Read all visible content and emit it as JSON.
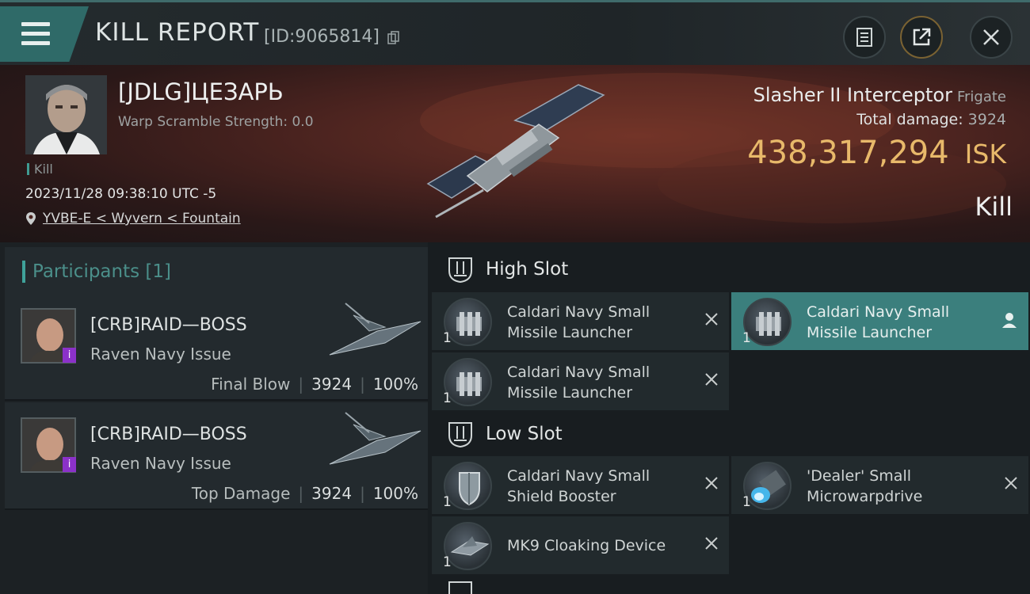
{
  "header": {
    "title": "KILL REPORT",
    "report_id": "[ID:9065814]"
  },
  "victim": {
    "name": "[JDLG]ЦЕЗАРЬ",
    "warp_scramble": "Warp Scramble Strength: 0.0",
    "tag": "Kill",
    "datetime": "2023/11/28 09:38:10 UTC -5",
    "location": "YVBE-E < Wyvern < Fountain",
    "ship": "Slasher II Interceptor",
    "ship_class": "Frigate",
    "total_damage_label": "Total damage:",
    "total_damage": "3924",
    "isk_value": "438,317,294",
    "isk_unit": "ISK",
    "result": "Kill"
  },
  "participants": {
    "label": "Participants",
    "count": "[1]",
    "items": [
      {
        "name": "[CRB]RAID—BOSS",
        "ship": "Raven Navy Issue",
        "role": "Final Blow",
        "damage": "3924",
        "percent": "100%"
      },
      {
        "name": "[CRB]RAID—BOSS",
        "ship": "Raven Navy Issue",
        "role": "Top Damage",
        "damage": "3924",
        "percent": "100%"
      }
    ]
  },
  "fitting": {
    "high_slot_label": "High Slot",
    "low_slot_label": "Low Slot",
    "high": [
      {
        "name": "Caldari Navy Small Missile Launcher",
        "qty": "1"
      },
      {
        "name": "Caldari Navy Small Missile Launcher",
        "qty": "1"
      },
      {
        "name": "Caldari Navy Small Missile Launcher",
        "qty": "1"
      }
    ],
    "low": [
      {
        "name": "Caldari Navy Small Shield Booster",
        "qty": "1"
      },
      {
        "name": "'Dealer' Small Microwarpdrive",
        "qty": "1"
      },
      {
        "name": "MK9 Cloaking Device",
        "qty": "1"
      }
    ]
  },
  "colors": {
    "accent": "#3b7f7d",
    "isk": "#e8b96a",
    "badge": "#8b31c9"
  },
  "icons": [
    "menu-icon",
    "copy-icon",
    "report-icon",
    "share-icon",
    "close-icon",
    "location-pin-icon",
    "slot-icon",
    "person-icon"
  ]
}
